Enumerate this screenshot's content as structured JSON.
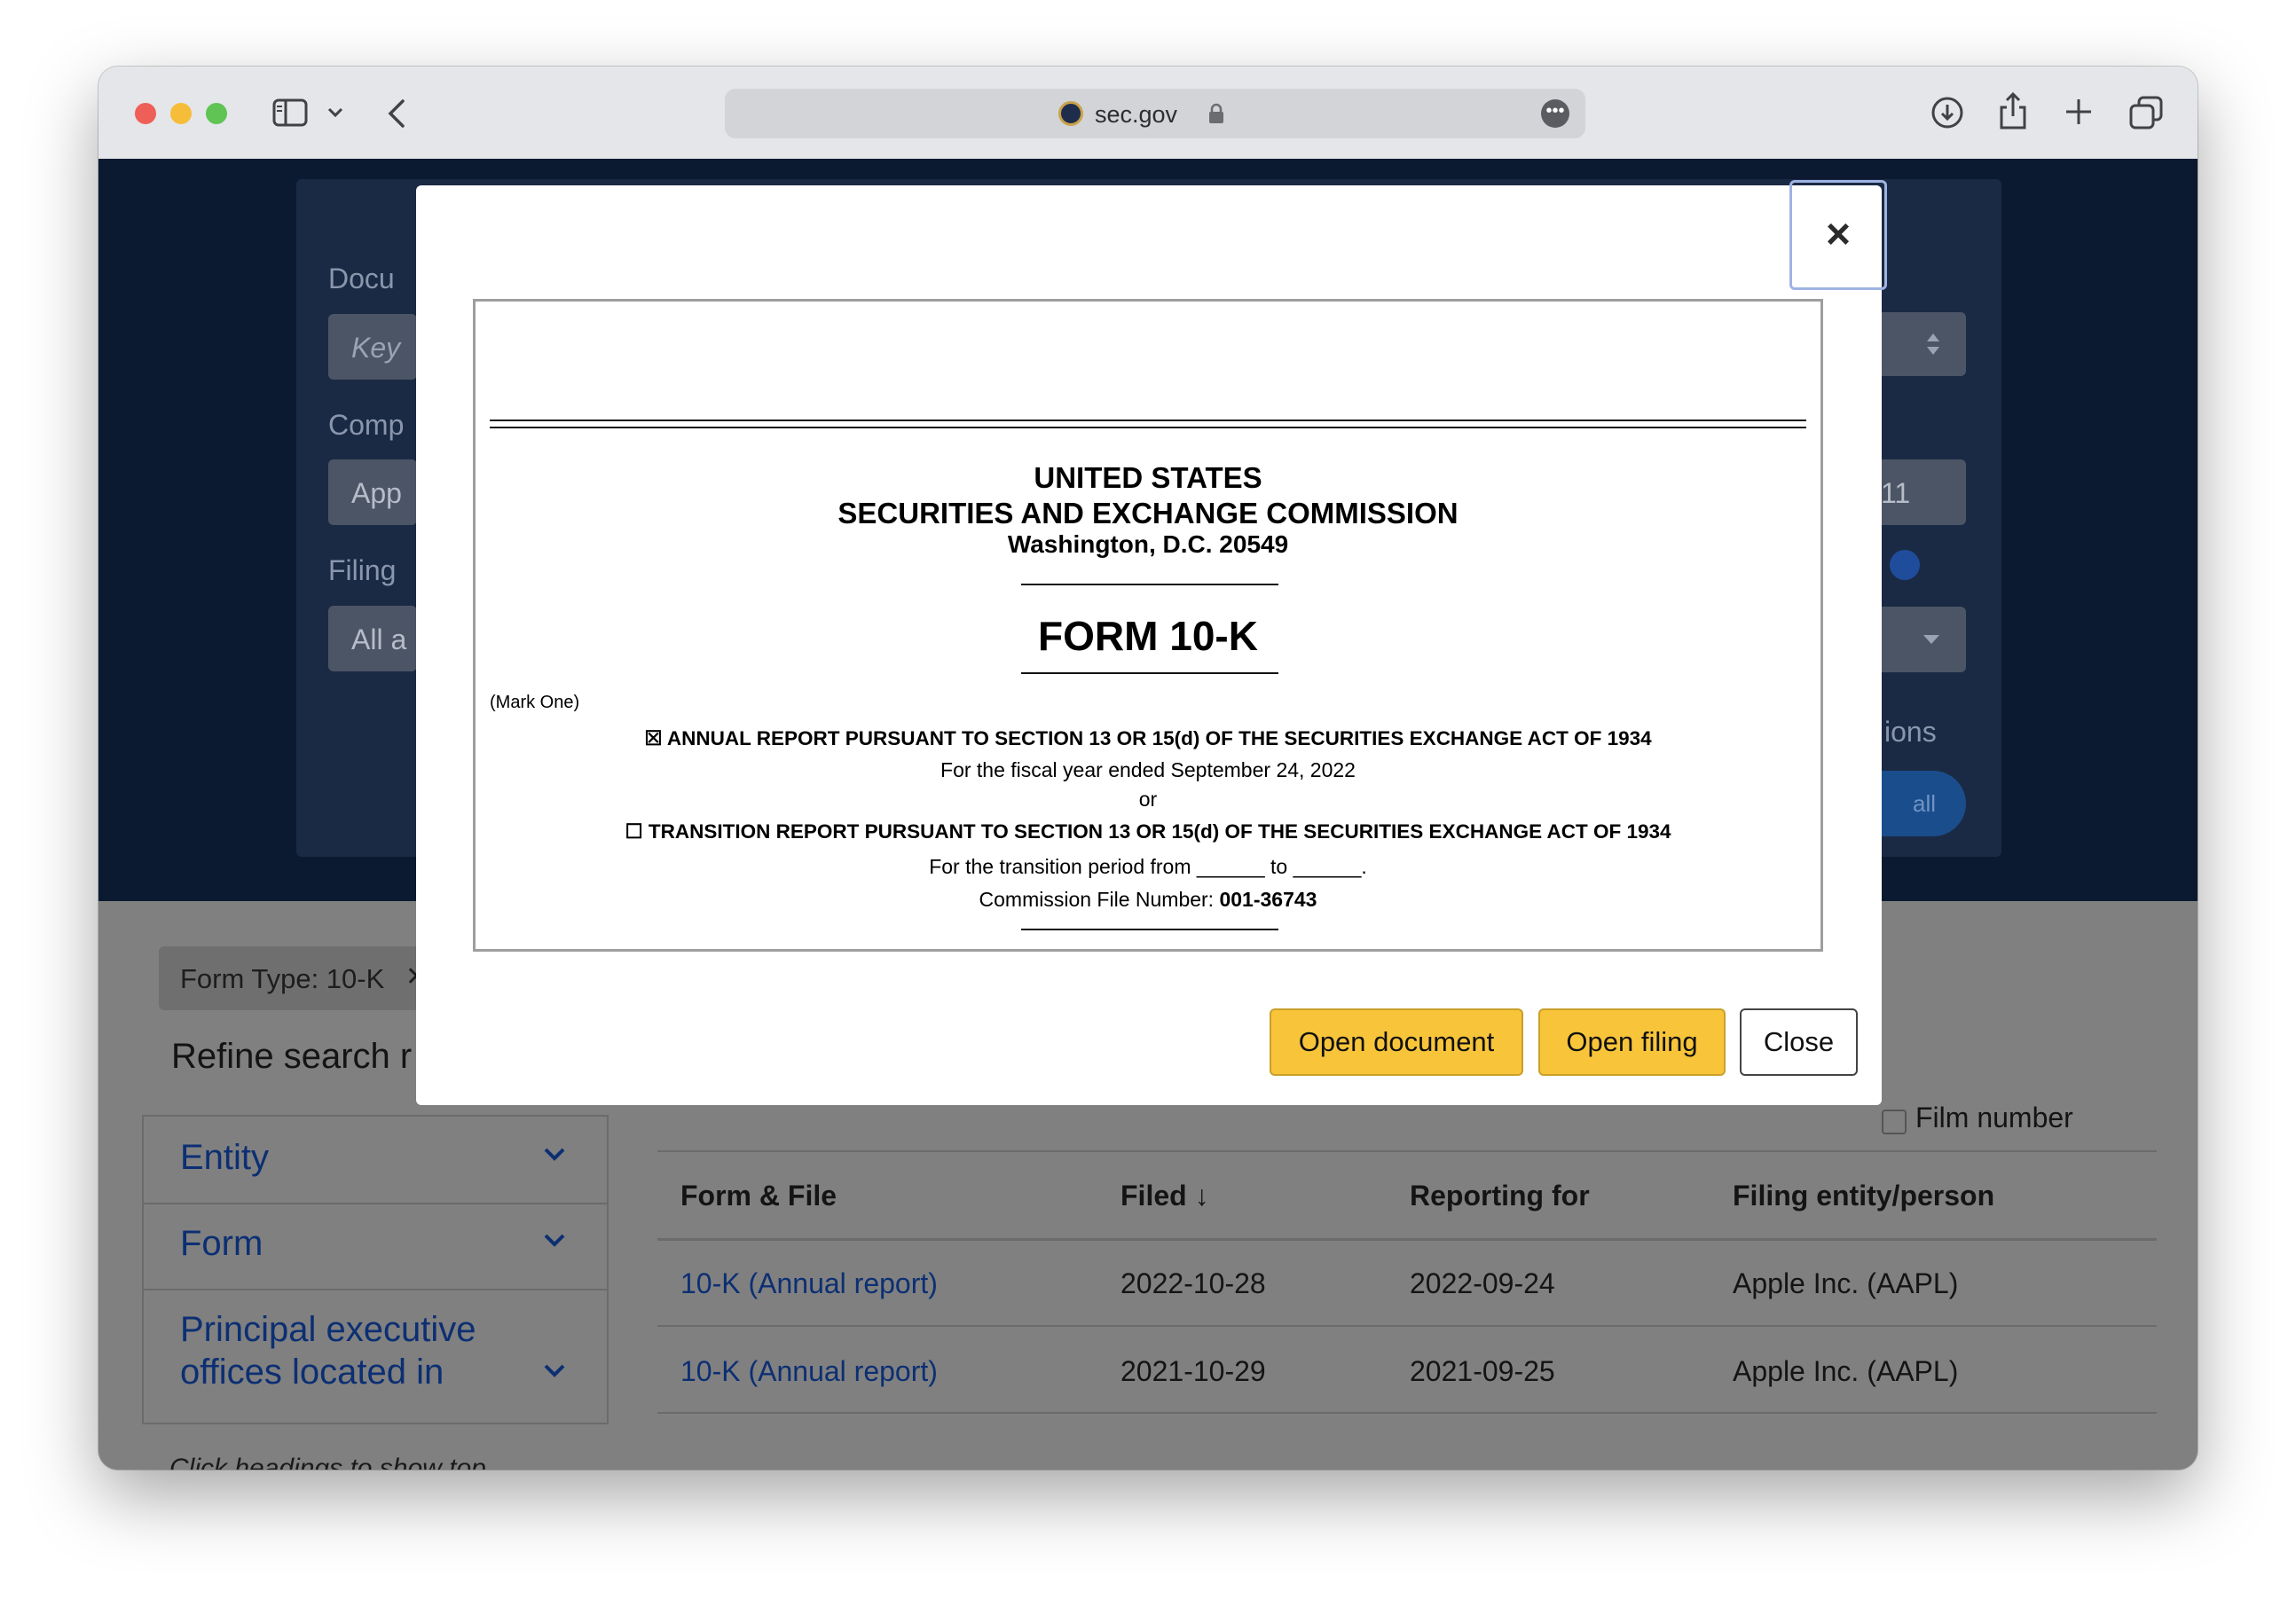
{
  "browser": {
    "url": "sec.gov"
  },
  "hero": {
    "labels": [
      "Docu",
      "Comp",
      "Filing"
    ],
    "inputs": [
      "Key",
      "App",
      "All a"
    ],
    "right_value": "11",
    "right_text": "ions",
    "pill": "all"
  },
  "results": {
    "chip": "Form Type: 10-K",
    "refine_title": "Refine search r",
    "facets": [
      "Entity",
      "Form",
      "Principal executive offices located in"
    ],
    "hint": "Click headings to show top",
    "film_number_label": "Film number",
    "columns": [
      "Form & File",
      "Filed ↓",
      "Reporting for",
      "Filing entity/person"
    ],
    "rows": [
      {
        "form": "10-K (Annual report)",
        "filed": "2022-10-28",
        "reporting_for": "2022-09-24",
        "entity": "Apple Inc. (AAPL)"
      },
      {
        "form": "10-K (Annual report)",
        "filed": "2021-10-29",
        "reporting_for": "2021-09-25",
        "entity": "Apple Inc. (AAPL)"
      }
    ]
  },
  "modal": {
    "close_symbol": "×",
    "doc": {
      "line1": "UNITED STATES",
      "line2": "SECURITIES AND EXCHANGE COMMISSION",
      "line3": "Washington, D.C. 20549",
      "form_title": "FORM 10-K",
      "mark_one": "(Mark One)",
      "annual_box": "☒",
      "annual": "ANNUAL REPORT PURSUANT TO SECTION 13 OR 15(d) OF THE SECURITIES EXCHANGE ACT OF 1934",
      "fiscal_year": "For the fiscal year ended September 24, 2022",
      "or": "or",
      "transition_box": "☐",
      "transition": "TRANSITION REPORT PURSUANT TO SECTION 13 OR 15(d) OF THE SECURITIES EXCHANGE ACT OF 1934",
      "transition_period": "For the transition period from ______ to ______.",
      "commission_label": "Commission File Number:",
      "commission_number": "001-36743"
    },
    "buttons": {
      "open_document": "Open document",
      "open_filing": "Open filing",
      "close": "Close"
    }
  }
}
